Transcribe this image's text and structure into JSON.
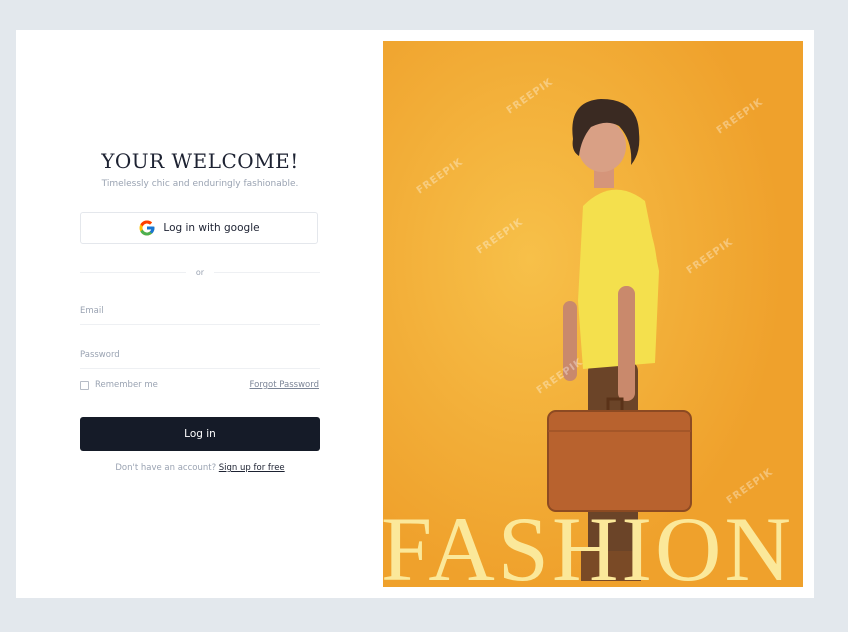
{
  "login": {
    "title": "YOUR WELCOME!",
    "subtitle": "Timelessly chic and enduringly fashionable.",
    "google_button": "Log in with google",
    "divider": "or",
    "email_placeholder": "Email",
    "password_placeholder": "Password",
    "remember_label": "Remember me",
    "forgot_link": "Forgot Password",
    "login_button": "Log in",
    "signup_prompt": "Don't have an account?",
    "signup_link": "Sign up for free"
  },
  "hero": {
    "headline": "FASHION",
    "watermark": "FREEPIK",
    "background_color": "#f2ad38"
  },
  "colors": {
    "primary_button": "#151b28",
    "accent_text": "#fbe89a",
    "page_background": "#e3e8ed"
  },
  "icons": {
    "google": "google-logo-icon"
  }
}
